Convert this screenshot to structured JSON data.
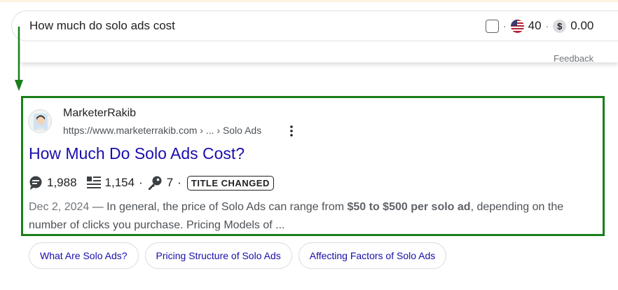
{
  "search": {
    "query": "How much do solo ads cost",
    "volume": "40",
    "cpc": "0.00",
    "dollar_symbol": "$",
    "separator": "·",
    "feedback": "Feedback"
  },
  "result": {
    "site_name": "MarketerRakib",
    "url": "https://www.marketerrakib.com › ... › Solo Ads",
    "title": "How Much Do Solo Ads Cost?",
    "stats": {
      "comments": "1,988",
      "words": "1,154",
      "keys": "7",
      "separator": "·",
      "badge": "TITLE CHANGED"
    },
    "snippet": {
      "date": "Dec 2, 2024",
      "dash": " — ",
      "text_before": "In general, the price of Solo Ads can range from ",
      "highlight": "$50 to $500 per solo ad",
      "text_after": ", depending on the number of clicks you purchase. Pricing Models of ..."
    }
  },
  "chips": [
    "What Are Solo Ads?",
    "Pricing Structure of Solo Ads",
    "Affecting Factors of Solo Ads"
  ],
  "colors": {
    "highlight_border": "#1a7e1a",
    "title_link": "#1a0dab",
    "arrow": "#1a7e1a"
  },
  "icons": {
    "flag": "us-flag-icon",
    "comments": "comment-bubble-icon",
    "words": "text-lines-icon",
    "keys": "key-icon",
    "more": "more-vertical-icon"
  }
}
